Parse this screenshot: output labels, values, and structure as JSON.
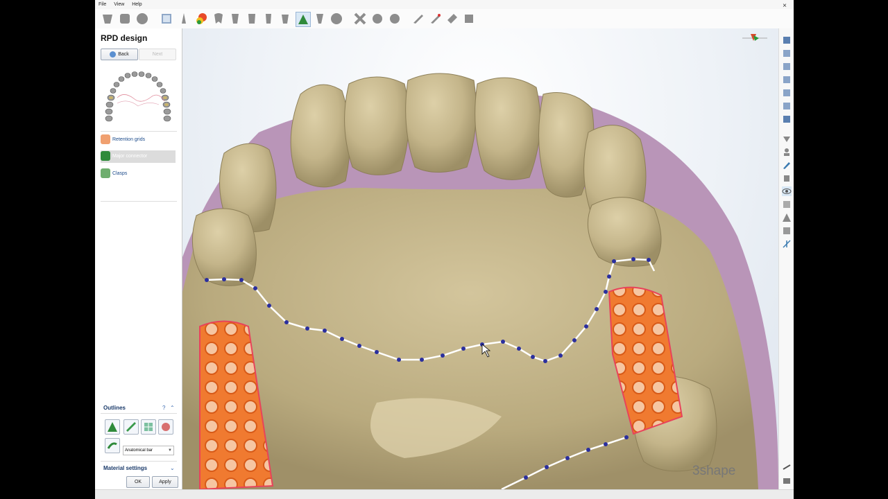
{
  "menu": {
    "file": "File",
    "view": "View",
    "help": "Help",
    "close": "×"
  },
  "panel": {
    "title": "RPD design",
    "back_label": "Back",
    "next_label": "Next",
    "steps": [
      {
        "label": "Retention grids",
        "state": "done"
      },
      {
        "label": "Major connector",
        "state": "active"
      },
      {
        "label": "Clasps",
        "state": "pending"
      }
    ],
    "outlines": {
      "label": "Outlines",
      "help": "?",
      "collapse": "⌃",
      "bar_type": "Anatomical bar"
    },
    "material": {
      "label": "Material settings",
      "expand": "⌄"
    },
    "ok_label": "OK",
    "apply_label": "Apply"
  },
  "viewport": {
    "brand": "3shape",
    "colors": {
      "tooth": "#c8b990",
      "gum": "#b995b8",
      "mesh": "#f07a30",
      "connector": "#ffffff",
      "control_point": "#2b2f9e"
    }
  },
  "toolbar_icons": [
    "teeth-icon",
    "tooth-icon",
    "circle-icon",
    "scan-icon",
    "pin-icon",
    "paint-icon",
    "tooth-icon",
    "tooth-icon",
    "tooth-icon",
    "tooth-icon",
    "tooth-icon",
    "rpd-icon",
    "tooth-icon",
    "circle-icon",
    "wrench-icon",
    "wrench-icon",
    "wrench-icon",
    "knife-icon",
    "knife-icon",
    "wax-icon",
    "wax-icon"
  ],
  "rightbar_icons": [
    "view-front-icon",
    "view-back-icon",
    "view-left-icon",
    "view-right-icon",
    "view-top-icon",
    "view-bottom-icon",
    "view-iso-icon",
    "clip-icon",
    "person-icon",
    "brush-icon",
    "scanner-icon",
    "eye-icon",
    "transparency-icon",
    "warning-icon",
    "box-icon",
    "axis-icon",
    "settings-icon",
    "camera-icon"
  ]
}
